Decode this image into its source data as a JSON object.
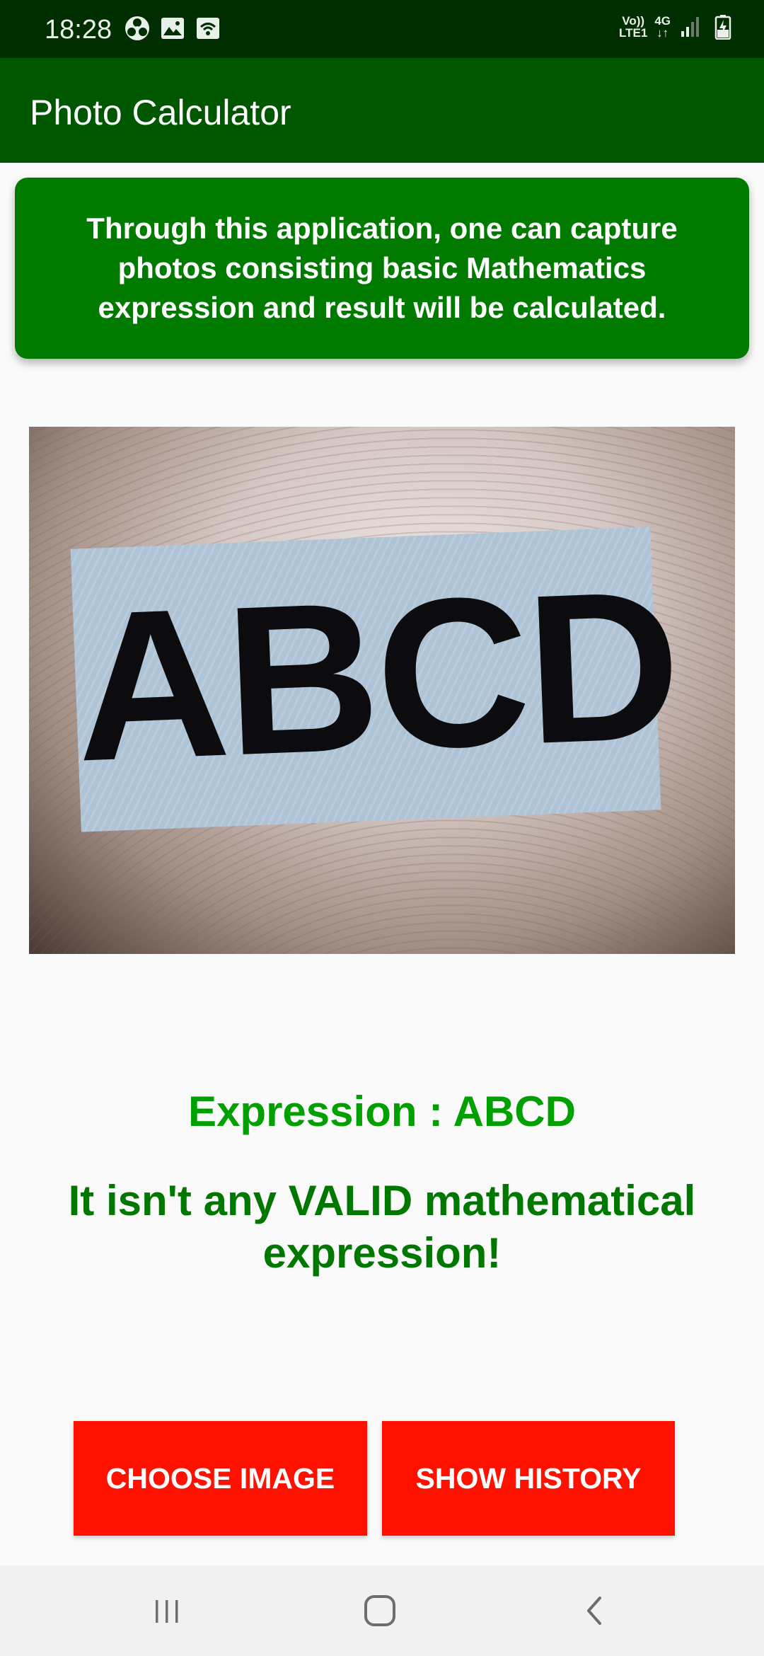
{
  "status_bar": {
    "time": "18:28",
    "left_icons": [
      "fan-icon",
      "gallery-icon",
      "wifi-calling-icon"
    ],
    "net_top": "Vo))",
    "net_bottom": "LTE1",
    "gen_top": "4G",
    "gen_bottom": "↓↑",
    "right_icons": [
      "signal-icon",
      "battery-charging-icon"
    ]
  },
  "app_bar": {
    "title": "Photo Calculator"
  },
  "banner": {
    "text": "Through this application, one can capture photos consisting basic Mathematics expression and result will be calculated."
  },
  "photo": {
    "text": "ABCD"
  },
  "result": {
    "expression": "Expression : ABCD",
    "message": "It isn't any VALID mathematical expression!"
  },
  "buttons": {
    "choose_image": "CHOOSE IMAGE",
    "show_history": "SHOW HISTORY"
  },
  "nav": {
    "icons": [
      "recent-apps-icon",
      "home-icon",
      "back-icon"
    ]
  },
  "colors": {
    "status_bar": "#002e00",
    "app_bar": "#005700",
    "banner": "#007b00",
    "expression": "#00a000",
    "message": "#007800",
    "button": "#ff1100"
  }
}
